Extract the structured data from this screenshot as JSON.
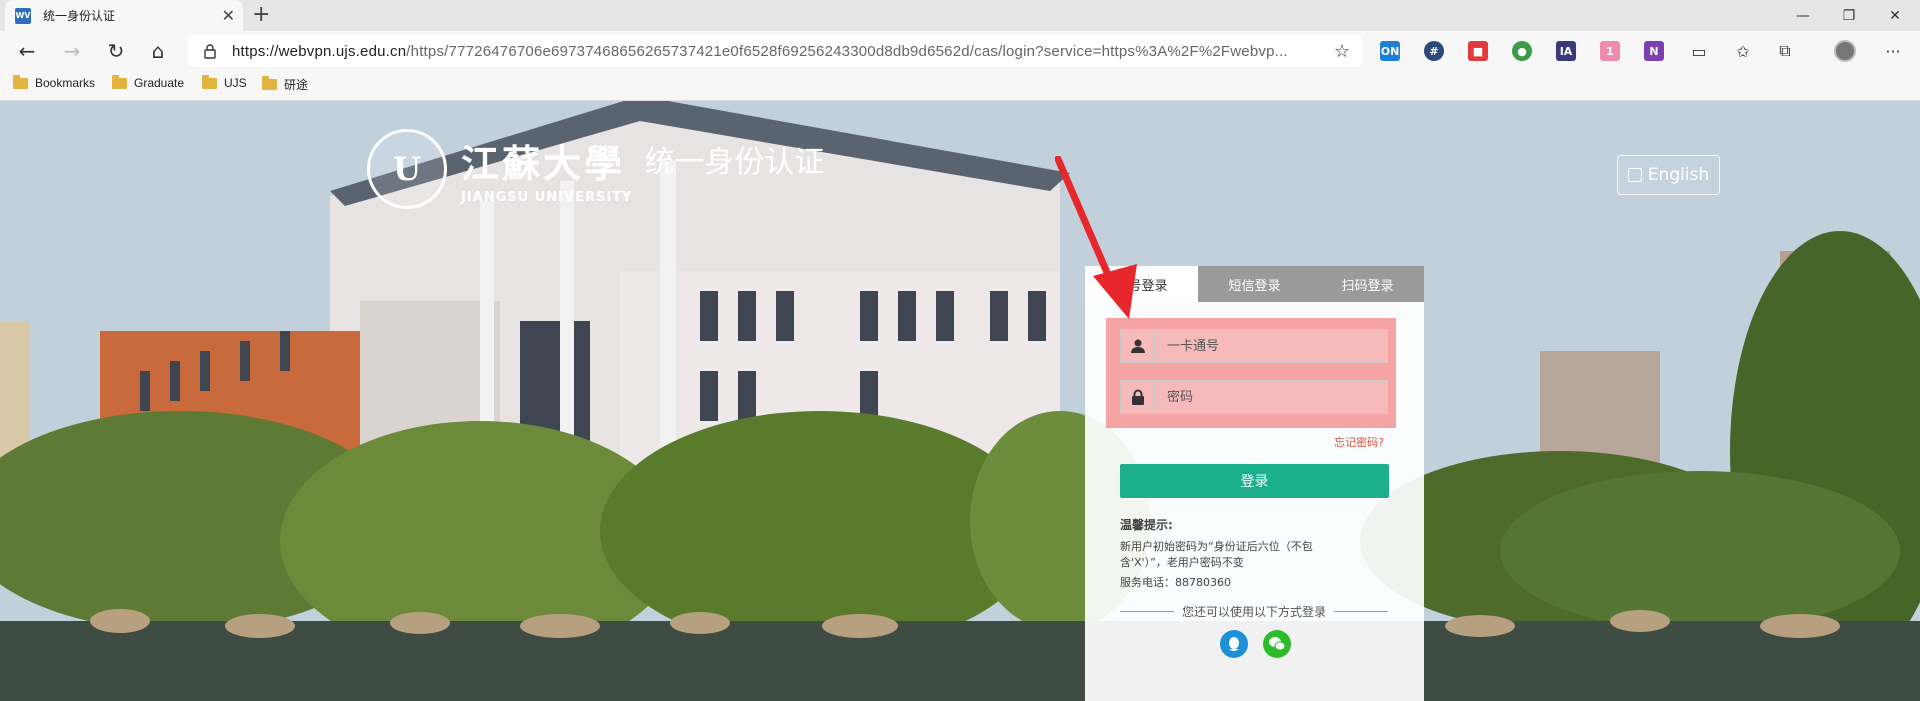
{
  "browser": {
    "tab_title": "统一身份认证",
    "favicon_label": "WV",
    "url_host": "https://webvpn.ujs.edu.cn",
    "url_path": "/https/77726476706e69737468656265737421e0f6528f69256243300d8db9d6562d/cas/login?service=https%3A%2F%2Fwebvp...",
    "icons": [
      "back-icon",
      "forward-icon",
      "refresh-icon",
      "home-icon",
      "lock-icon",
      "star-icon"
    ],
    "extensions": [
      {
        "name": "ext-on-icon",
        "label": "ON",
        "color": "#1e7fd8"
      },
      {
        "name": "ext-hash-icon",
        "label": "#",
        "color": "#2b4a7a"
      },
      {
        "name": "ext-red-icon",
        "label": "■",
        "color": "#e23b3b"
      },
      {
        "name": "ext-globe-icon",
        "label": "●",
        "color": "#3c9a49"
      },
      {
        "name": "ext-ia-icon",
        "label": "IA",
        "color": "#3a3a7a"
      },
      {
        "name": "ext-pink-icon",
        "label": "1",
        "color": "#f08bb0"
      },
      {
        "name": "ext-onenote-icon",
        "label": "N",
        "color": "#7b3fb0"
      }
    ]
  },
  "bookmarks": [
    {
      "label": "Bookmarks"
    },
    {
      "label": "Graduate"
    },
    {
      "label": "UJS"
    },
    {
      "label": "研途"
    }
  ],
  "logo": {
    "cn": "江蘇大學",
    "en": "JIANGSU UNIVERSITY",
    "title": "统一身份认证"
  },
  "lang_button": "English",
  "login": {
    "tabs": [
      "账号登录",
      "短信登录",
      "扫码登录"
    ],
    "username_placeholder": "一卡通号",
    "password_placeholder": "密码",
    "forgot": "忘记密码?",
    "submit": "登录",
    "tips_title": "温馨提示:",
    "tips_line1": "新用户初始密码为“身份证后六位（不包",
    "tips_line2": "含'X'）”，老用户密码不变",
    "tips_phone": "服务电话：88780360",
    "alt_text": "您还可以使用以下方式登录"
  },
  "colors": {
    "accent": "#1bb08b",
    "highlight": "#f05a5a",
    "arrow": "#e8272d",
    "qq": "#1e90d8",
    "wechat": "#2bbb2b"
  }
}
